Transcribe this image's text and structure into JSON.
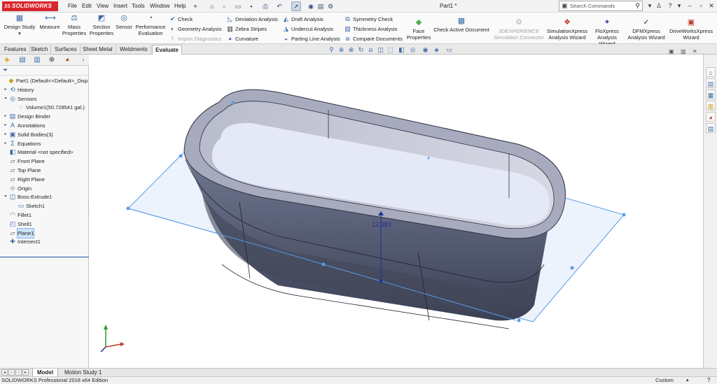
{
  "app": {
    "logo_text": "SOLIDWORKS",
    "doc_title": "Part1 *",
    "accent": "#d8262e"
  },
  "menu": [
    "File",
    "Edit",
    "View",
    "Insert",
    "Tools",
    "Window",
    "Help"
  ],
  "search": {
    "placeholder": "Search Commands"
  },
  "ribbon": {
    "design_study": "Design Study",
    "measure": "Measure",
    "mass_properties": [
      "Mass",
      "Properties"
    ],
    "section_properties": [
      "Section",
      "Properties"
    ],
    "sensor": "Sensor",
    "performance_evaluation": [
      "Performance",
      "Evaluation"
    ],
    "check": "Check",
    "geometry_analysis": "Geometry Analysis",
    "import_diagnostics": "Import Diagnostics",
    "deviation_analysis": "Deviation Analysis",
    "zebra_stripes": "Zebra Stripes",
    "curvature": "Curvature",
    "draft_analysis": "Draft Analysis",
    "undercut_analysis": "Undercut Analysis",
    "parting_line_analysis": "Parting Line Analysis",
    "symmetry_check": "Symmetry Check",
    "thickness_analysis": "Thickness Analysis",
    "compare_documents": "Compare Documents",
    "face_properties": [
      "Face",
      "Properties"
    ],
    "check_active_document": "Check Active Document",
    "threedexperience": [
      "3DEXPERIENCE",
      "Simulation Connector"
    ],
    "simulationxpress": [
      "SimulationXpress",
      "Analysis Wizard"
    ],
    "floxpress": [
      "FloXpress",
      "Analysis Wizard"
    ],
    "dfmxpress": [
      "DFMXpress",
      "Analysis Wizard"
    ],
    "driveworksxpress": [
      "DriveWorksXpress",
      "Wizard"
    ]
  },
  "command_tabs": [
    "Features",
    "Sketch",
    "Surfaces",
    "Sheet Metal",
    "Weldments",
    "Evaluate"
  ],
  "active_command_tab": "Evaluate",
  "tree": {
    "items": [
      {
        "label": "Part1  (Default<<Default>_Disp",
        "icon": "part-icon",
        "expander": ""
      },
      {
        "label": "History",
        "icon": "history-icon",
        "expander": "▸"
      },
      {
        "label": "Sensors",
        "icon": "sensors-icon",
        "expander": "▾"
      },
      {
        "label": "Volume1(50.728541 gal.)",
        "icon": "sensor-icon",
        "expander": ""
      },
      {
        "label": "Design Binder",
        "icon": "binder-icon",
        "expander": "▸"
      },
      {
        "label": "Annotations",
        "icon": "annotations-icon",
        "expander": "▸"
      },
      {
        "label": "Solid Bodies(3)",
        "icon": "solid-bodies-icon",
        "expander": "▸"
      },
      {
        "label": "Equations",
        "icon": "equations-icon",
        "expander": "▸"
      },
      {
        "label": "Material <not specified>",
        "icon": "material-icon",
        "expander": ""
      },
      {
        "label": "Front Plane",
        "icon": "plane-icon",
        "expander": ""
      },
      {
        "label": "Top Plane",
        "icon": "plane-icon",
        "expander": ""
      },
      {
        "label": "Right Plane",
        "icon": "plane-icon",
        "expander": ""
      },
      {
        "label": "Origin",
        "icon": "origin-icon",
        "expander": ""
      },
      {
        "label": "Boss-Extrude1",
        "icon": "extrude-icon",
        "expander": "▾"
      },
      {
        "label": "Sketch1",
        "icon": "sketch-icon",
        "expander": ""
      },
      {
        "label": "Fillet1",
        "icon": "fillet-icon",
        "expander": ""
      },
      {
        "label": "Shell1",
        "icon": "shell-icon",
        "expander": ""
      },
      {
        "label": "Plane1",
        "icon": "plane-icon",
        "expander": ""
      },
      {
        "label": "Intersect1",
        "icon": "intersect-icon",
        "expander": ""
      }
    ],
    "selected": "Plane1"
  },
  "viewport": {
    "dimension_value": "12.383"
  },
  "bottom_tabs": [
    "Model",
    "Motion Study 1"
  ],
  "status": {
    "left": "SOLIDWORKS Professional 2018 x64 Edition",
    "units": "Custom"
  }
}
